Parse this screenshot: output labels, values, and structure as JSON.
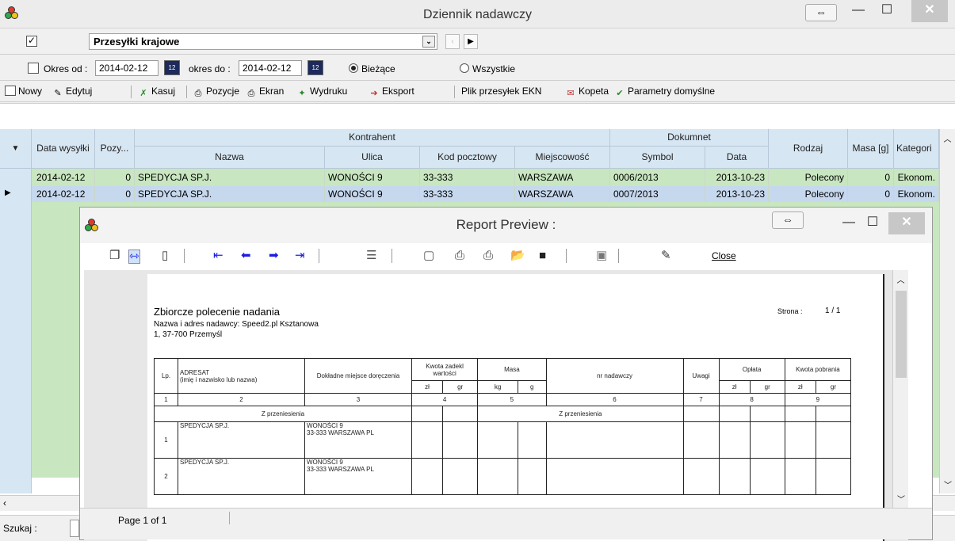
{
  "window": {
    "title": "Dziennik nadawczy",
    "swap_symbol": "⇔",
    "min_symbol": "—",
    "max_symbol": "☐",
    "close_symbol": "✕"
  },
  "filter": {
    "checked_mark": "✓",
    "combo_value": "Przesyłki krajowe",
    "combo_arrow": "⌄"
  },
  "dates": {
    "okres_od_label": "Okres od :",
    "date_from": "2014-02-12",
    "okres_do_label": "okres do :",
    "date_to": "2014-02-12",
    "radio_current": "Bieżące",
    "radio_all": "Wszystkie"
  },
  "toolbar": {
    "items": [
      "Nowy",
      "Edytuj",
      "Kasuj",
      "Pozycje",
      "Ekran",
      "Wydruku",
      "Eksport",
      "Plik przesyłek EKN",
      "Kopeta",
      "Parametry domyślne"
    ]
  },
  "grid": {
    "headers": {
      "data_wysylki": "Data wysyłki",
      "pozycje": "Pozy...",
      "kontrahent": "Kontrahent",
      "nazwa": "Nazwa",
      "ulica": "Ulica",
      "kod": "Kod pocztowy",
      "miejscowosc": "Miejscowość",
      "dokument": "Dokumnet",
      "symbol": "Symbol",
      "data": "Data",
      "rodzaj": "Rodzaj",
      "masa": "Masa [g]",
      "kategoria": "Kategori"
    },
    "rows": [
      {
        "data": "2014-02-12",
        "poz": "0",
        "nazwa": "SPEDYCJA SP.J.",
        "ulica": "WONOŚCI 9",
        "kod": "33-333",
        "miejscowosc": "WARSZAWA",
        "symbol": "0006/2013",
        "data_dok": "2013-10-23",
        "rodzaj": "Polecony",
        "masa": "0",
        "kategoria": "Ekonom."
      },
      {
        "data": "2014-02-12",
        "poz": "0",
        "nazwa": "SPEDYCJA SP.J.",
        "ulica": "WONOŚCI 9",
        "kod": "33-333",
        "miejscowosc": "WARSZAWA",
        "symbol": "0007/2013",
        "data_dok": "2013-10-23",
        "rodzaj": "Polecony",
        "masa": "0",
        "kategoria": "Ekonom."
      }
    ]
  },
  "preview": {
    "title": "Report Preview :",
    "close_label": "Close",
    "page_status": "Page 1 of 1",
    "report": {
      "heading": "Zbiorcze polecenie nadania",
      "sender_line1": "Nazwa i adres nadawcy: Speed2.pl Ksztanowa",
      "sender_line2": "1, 37-700 Przemyśl",
      "page_label": "Strona :",
      "page_value": "1 / 1",
      "cols": {
        "lp": "Lp.",
        "adresat": "ADRESAT",
        "adresat_sub": "(imię i nazwisko lub nazwa)",
        "miejsce": "Dokładne miejsce doręczenia",
        "kwota": "Kwota zadekl wartości",
        "masa": "Masa",
        "nr": "nr nadawczy",
        "uwagi": "Uwagi",
        "oplata": "Opłata",
        "pobranie": "Kwota pobrania",
        "zl": "zł",
        "gr": "gr",
        "kg": "kg",
        "g": "g"
      },
      "nums": [
        "1",
        "2",
        "3",
        "4",
        "5",
        "6",
        "7",
        "8",
        "9"
      ],
      "carry": "Z przeniesienia",
      "rows": [
        {
          "lp": "1",
          "name": "SPEDYCJA SP.J.",
          "addr1": "WONOŚCI 9",
          "addr2": "33-333 WARSZAWA PL"
        },
        {
          "lp": "2",
          "name": "SPEDYCJA SP.J.",
          "addr1": "WONOŚCI 9",
          "addr2": "33-333 WARSZAWA PL"
        }
      ]
    }
  },
  "status": {
    "search_label": "Szukaj :"
  }
}
